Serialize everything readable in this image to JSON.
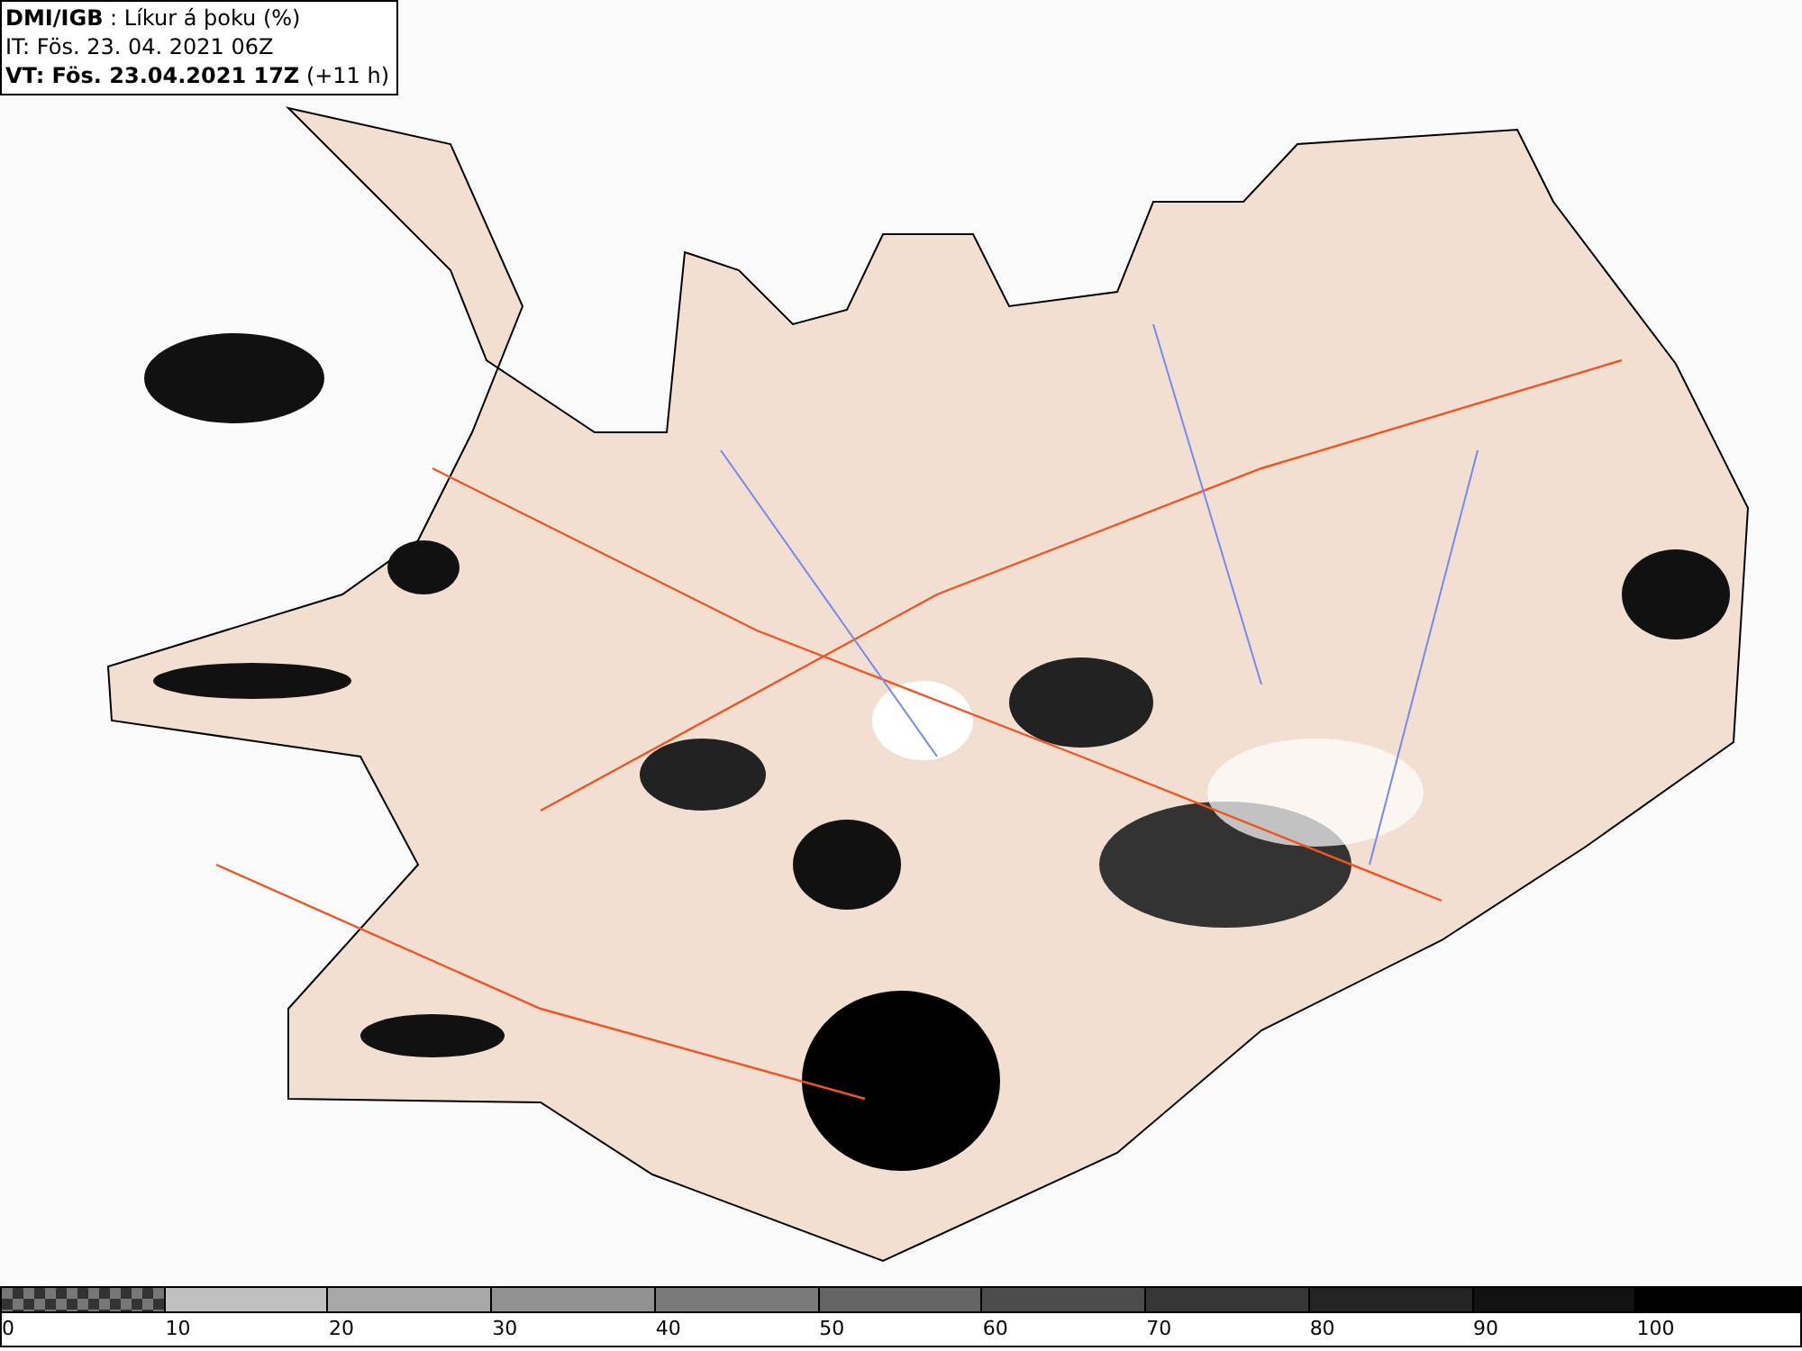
{
  "header": {
    "lines": [
      "**DMI/IGB** : Líkur á þoku (%)",
      "IT: Fös. 23. 04. 2021 06Z",
      "**VT: Fös. 23.04.2021 17Z** (+11 h)"
    ]
  },
  "legend": {
    "segments": [
      {
        "kind": "checker",
        "label": "0"
      },
      {
        "kind": "solid",
        "color": "#c0c0c0",
        "label": "10"
      },
      {
        "kind": "solid",
        "color": "#a8a8a8",
        "label": "20"
      },
      {
        "kind": "solid",
        "color": "#929292",
        "label": "30"
      },
      {
        "kind": "solid",
        "color": "#7a7a7a",
        "label": "40"
      },
      {
        "kind": "solid",
        "color": "#646464",
        "label": "50"
      },
      {
        "kind": "solid",
        "color": "#4c4c4c",
        "label": "60"
      },
      {
        "kind": "solid",
        "color": "#363636",
        "label": "70"
      },
      {
        "kind": "solid",
        "color": "#242424",
        "label": "80"
      },
      {
        "kind": "solid",
        "color": "#121212",
        "label": "90"
      },
      {
        "kind": "solid",
        "color": "#000000",
        "label": "100"
      }
    ]
  }
}
